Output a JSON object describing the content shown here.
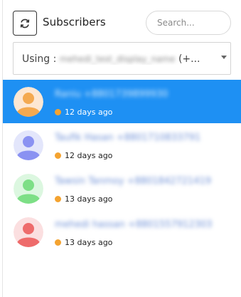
{
  "header": {
    "title": "Subscribers",
    "search_placeholder": "Search..."
  },
  "select": {
    "prefix": "Using : ",
    "value_blurred": "mehedi_test_display_name",
    "suffix": " (+..."
  },
  "subscribers": [
    {
      "name": "Raniu +8801739899930",
      "time": "12 days ago",
      "active": true,
      "avatar_bg": "#fde7d3",
      "avatar_fg": "#f4a950"
    },
    {
      "name": "Taufik Hasan +8801710833791",
      "time": "12 days ago",
      "active": false,
      "avatar_bg": "#e3e6fb",
      "avatar_fg": "#8a92f2"
    },
    {
      "name": "Tawsin Tanmoy +8801842721419",
      "time": "13 days ago",
      "active": false,
      "avatar_bg": "#dcf7e0",
      "avatar_fg": "#7ddf86"
    },
    {
      "name": "mehedi hassan +8801557912303",
      "time": "13 days ago",
      "active": false,
      "avatar_bg": "#fbdfe0",
      "avatar_fg": "#ee6b6b"
    }
  ],
  "colors": {
    "active_row": "#1e90f3",
    "status_dot": "#f4a330"
  },
  "icons": {
    "refresh": "refresh-icon",
    "caret": "caret-down-icon",
    "avatar": "user-avatar-icon",
    "status": "status-dot-icon"
  }
}
